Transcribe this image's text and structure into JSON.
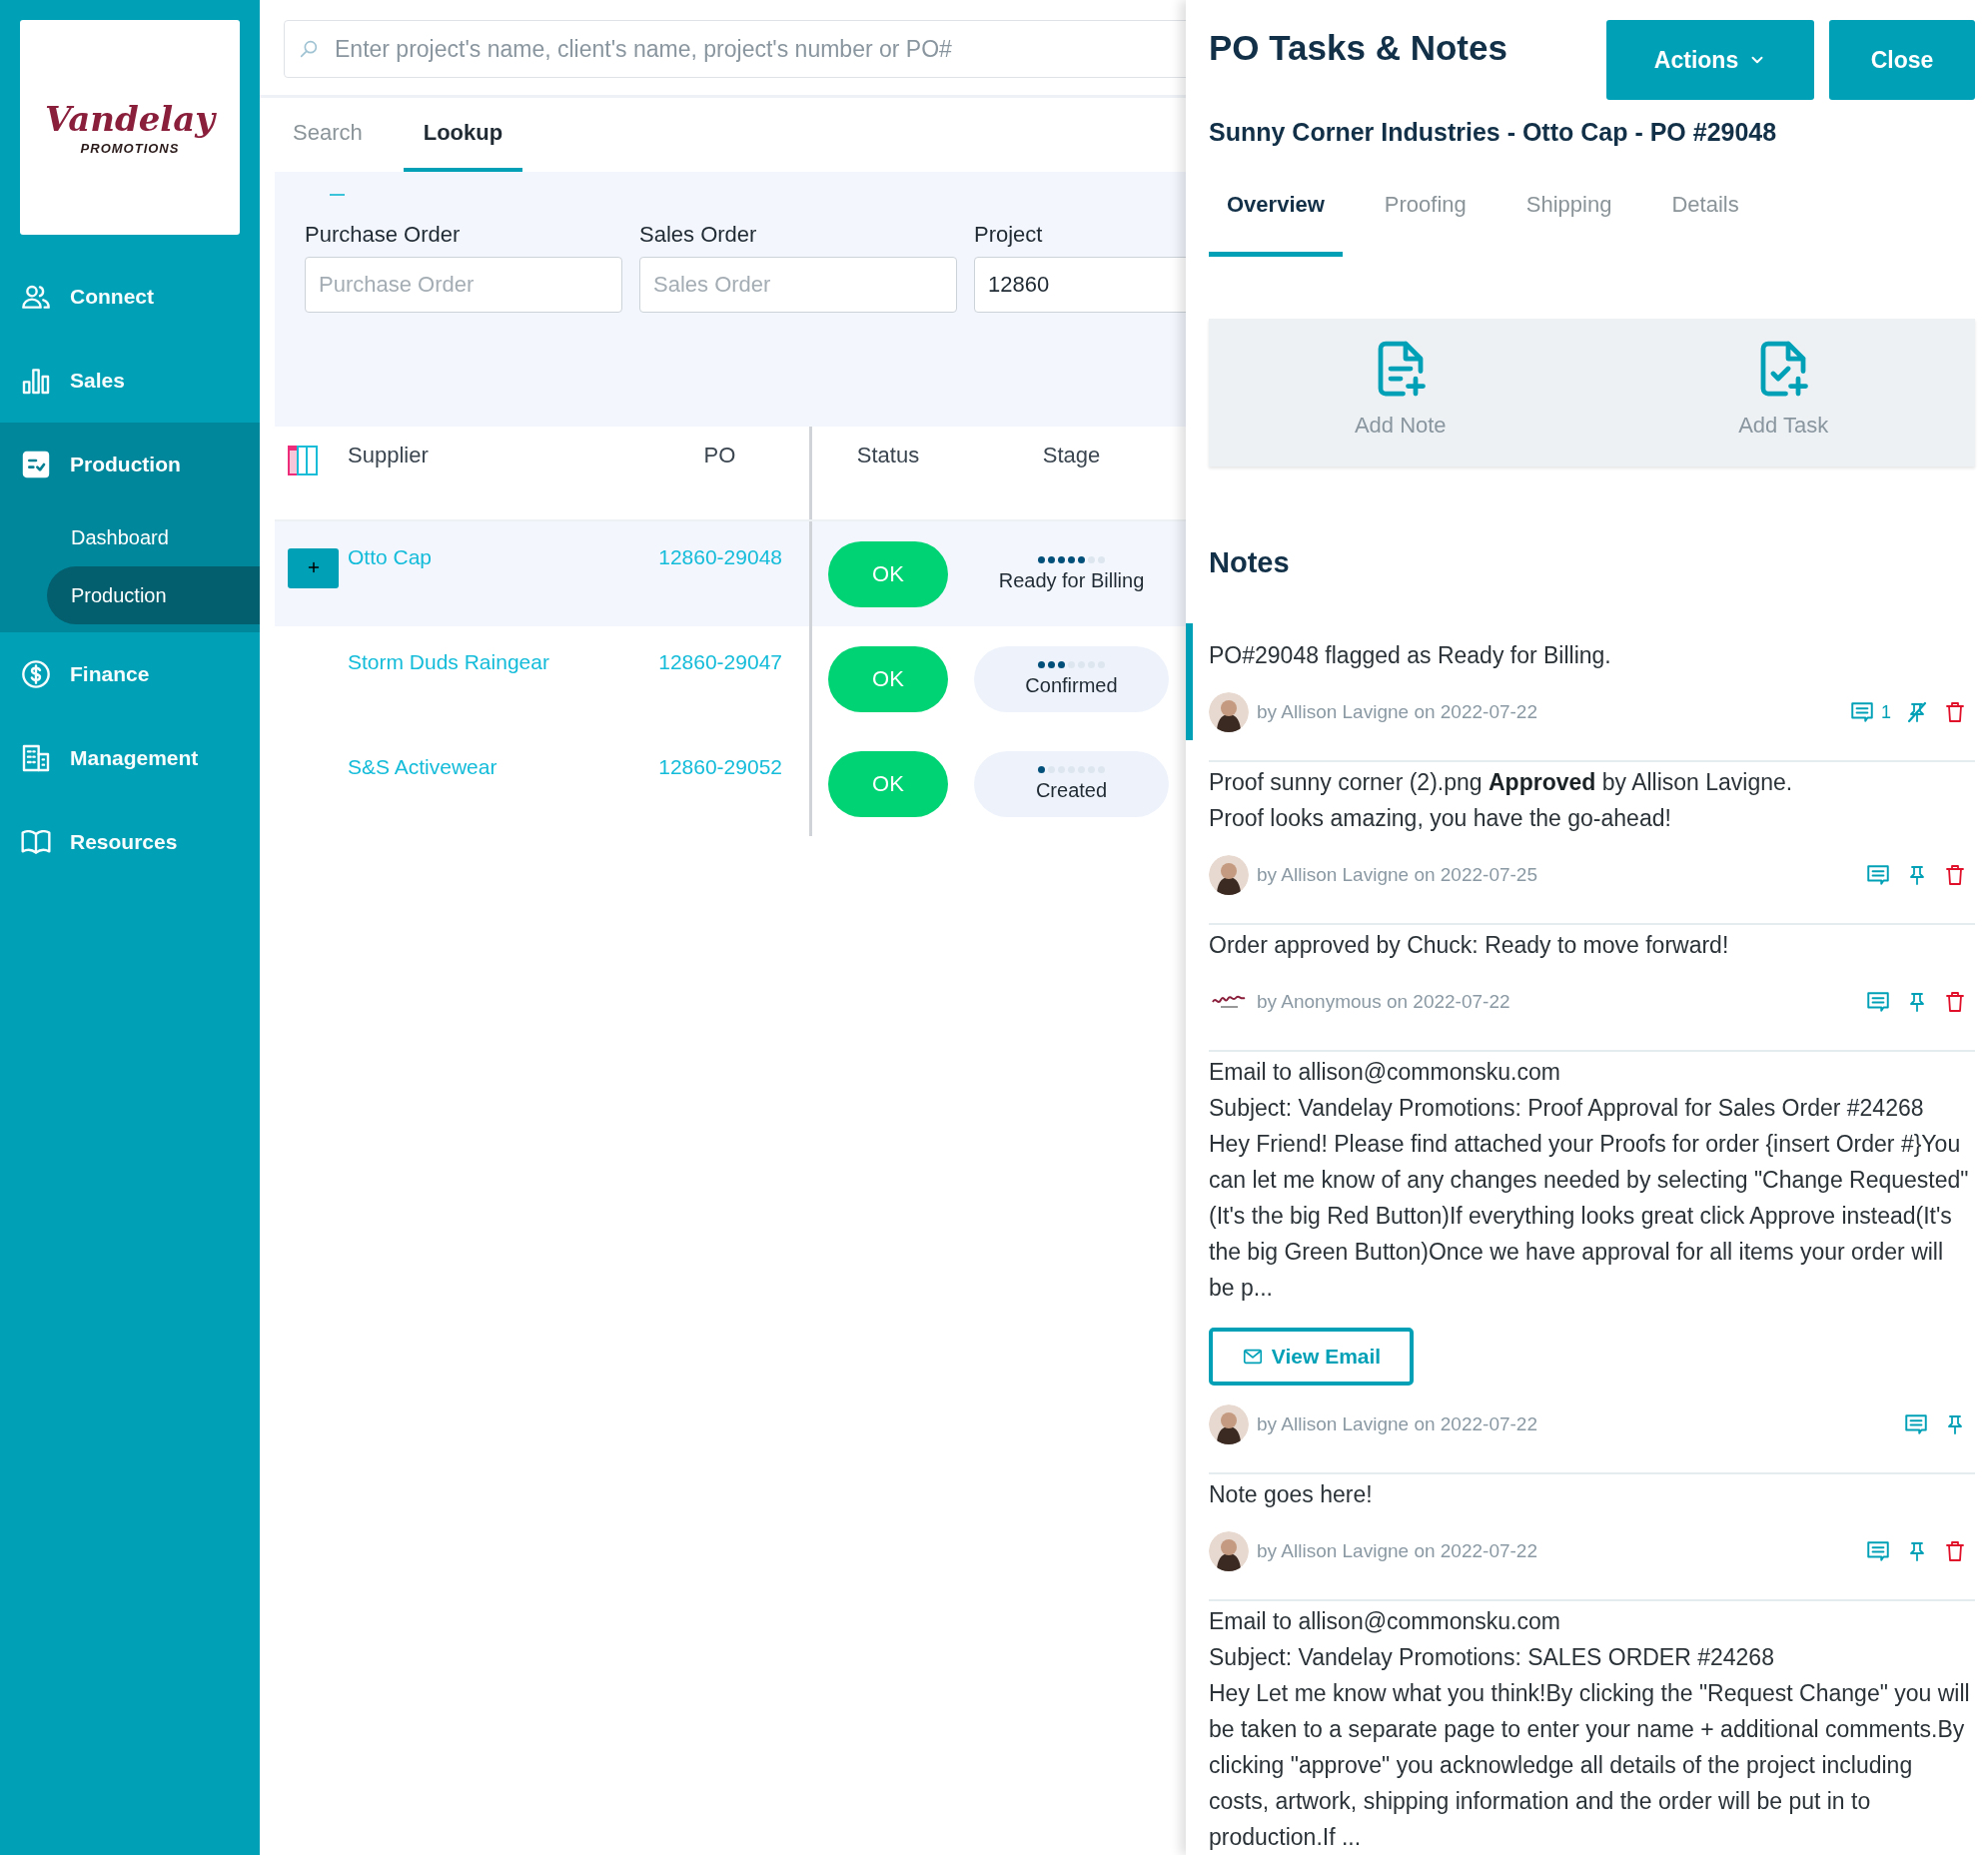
{
  "sidebar": {
    "logo": {
      "name": "Vandelay",
      "tagline": "PROMOTIONS"
    },
    "nav": [
      {
        "label": "Connect",
        "expanded": false
      },
      {
        "label": "Sales",
        "expanded": false
      },
      {
        "label": "Production",
        "expanded": true,
        "children": [
          {
            "label": "Dashboard",
            "selected": false
          },
          {
            "label": "Production",
            "selected": true
          }
        ]
      },
      {
        "label": "Finance",
        "expanded": false
      },
      {
        "label": "Management",
        "expanded": false
      },
      {
        "label": "Resources",
        "expanded": false
      }
    ]
  },
  "search": {
    "placeholder": "Enter project's name, client's name, project's number or PO#"
  },
  "tabs": [
    {
      "label": "Search",
      "selected": false
    },
    {
      "label": "Lookup",
      "selected": true
    }
  ],
  "lookup": {
    "fields": [
      {
        "label": "Purchase Order",
        "placeholder": "Purchase Order"
      },
      {
        "label": "Sales Order",
        "placeholder": "Sales Order"
      },
      {
        "label": "Project",
        "value": "12860"
      }
    ]
  },
  "table": {
    "columns": [
      "Supplier",
      "PO",
      "Status",
      "Stage"
    ],
    "rows": [
      {
        "supplier": "Otto Cap",
        "po": "12860-29048",
        "status": "OK",
        "stage": "Ready for Billing",
        "level": 0.714,
        "selected": true
      },
      {
        "supplier": "Storm Duds Raingear",
        "po": "12860-29047",
        "status": "OK",
        "stage": "Confirmed",
        "level": 0.429,
        "selected": false
      },
      {
        "supplier": "S&S Activewear",
        "po": "12860-29052",
        "status": "OK",
        "stage": "Created",
        "level": 0.143,
        "selected": false
      }
    ]
  },
  "panel": {
    "title": "PO Tasks & Notes",
    "buttons": [
      {
        "label": "Actions",
        "kind": "dropdown"
      },
      {
        "label": "Close",
        "kind": "plain"
      }
    ],
    "subtitle": "Sunny Corner Industries - Otto Cap - PO #29048",
    "tabs": [
      {
        "label": "Overview",
        "selected": true
      },
      {
        "label": "Proofing",
        "selected": false
      },
      {
        "label": "Shipping",
        "selected": false
      },
      {
        "label": "Details",
        "selected": false
      }
    ],
    "actions": [
      {
        "label": "Add Note",
        "kind": "note"
      },
      {
        "label": "Add Task",
        "kind": "task"
      }
    ],
    "notes_heading": "Notes",
    "notes": [
      {
        "paragraphs": [
          "PO#29048 flagged as Ready for Billing."
        ],
        "byline": "by Allison Lavigne on 2022-07-22",
        "avatar": {
          "kind": "photo"
        },
        "highlighted": true,
        "comments": "1",
        "pinned": true,
        "deletable": true
      },
      {
        "paragraphs": [
          "Proof sunny corner (2).png **Approved** by Allison Lavigne.",
          "Proof looks amazing, you have the go-ahead!"
        ],
        "byline": "by Allison Lavigne on 2022-07-25",
        "avatar": {
          "kind": "photo"
        },
        "highlighted": false,
        "pinned": false,
        "deletable": true
      },
      {
        "paragraphs": [
          "Order approved by Chuck: Ready to move forward!"
        ],
        "byline": "by Anonymous on 2022-07-22",
        "avatar": {
          "kind": "logo"
        },
        "highlighted": false,
        "pinned": false,
        "deletable": true
      },
      {
        "paragraphs": [
          "Email to allison@commonsku.com",
          "Subject: Vandelay Promotions: Proof Approval for Sales Order #24268",
          "Hey Friend! Please find attached your Proofs for order {insert Order #}You can let me know of any changes needed by selecting \"Change Requested\" (It's the big Red Button)If everything looks great click Approve instead(It's the big Green Button)Once we have approval for all items your order will be p..."
        ],
        "button": "View Email",
        "byline": "by Allison Lavigne on 2022-07-22",
        "avatar": {
          "kind": "photo"
        },
        "highlighted": false,
        "pinned": false,
        "deletable": false
      },
      {
        "paragraphs": [
          "Note goes here!"
        ],
        "byline": "by Allison Lavigne on 2022-07-22",
        "avatar": {
          "kind": "photo"
        },
        "highlighted": false,
        "pinned": false,
        "deletable": true
      },
      {
        "paragraphs": [
          "Email to allison@commonsku.com",
          "Subject: Vandelay Promotions: SALES ORDER #24268",
          "Hey Let me know what you think!By clicking the \"Request Change\" you will be taken to a separate page to enter your name + additional comments.By clicking \"approve\" you acknowledge all details of the project including costs, artwork, shipping information and the order will be put in to production.If ..."
        ]
      }
    ]
  }
}
